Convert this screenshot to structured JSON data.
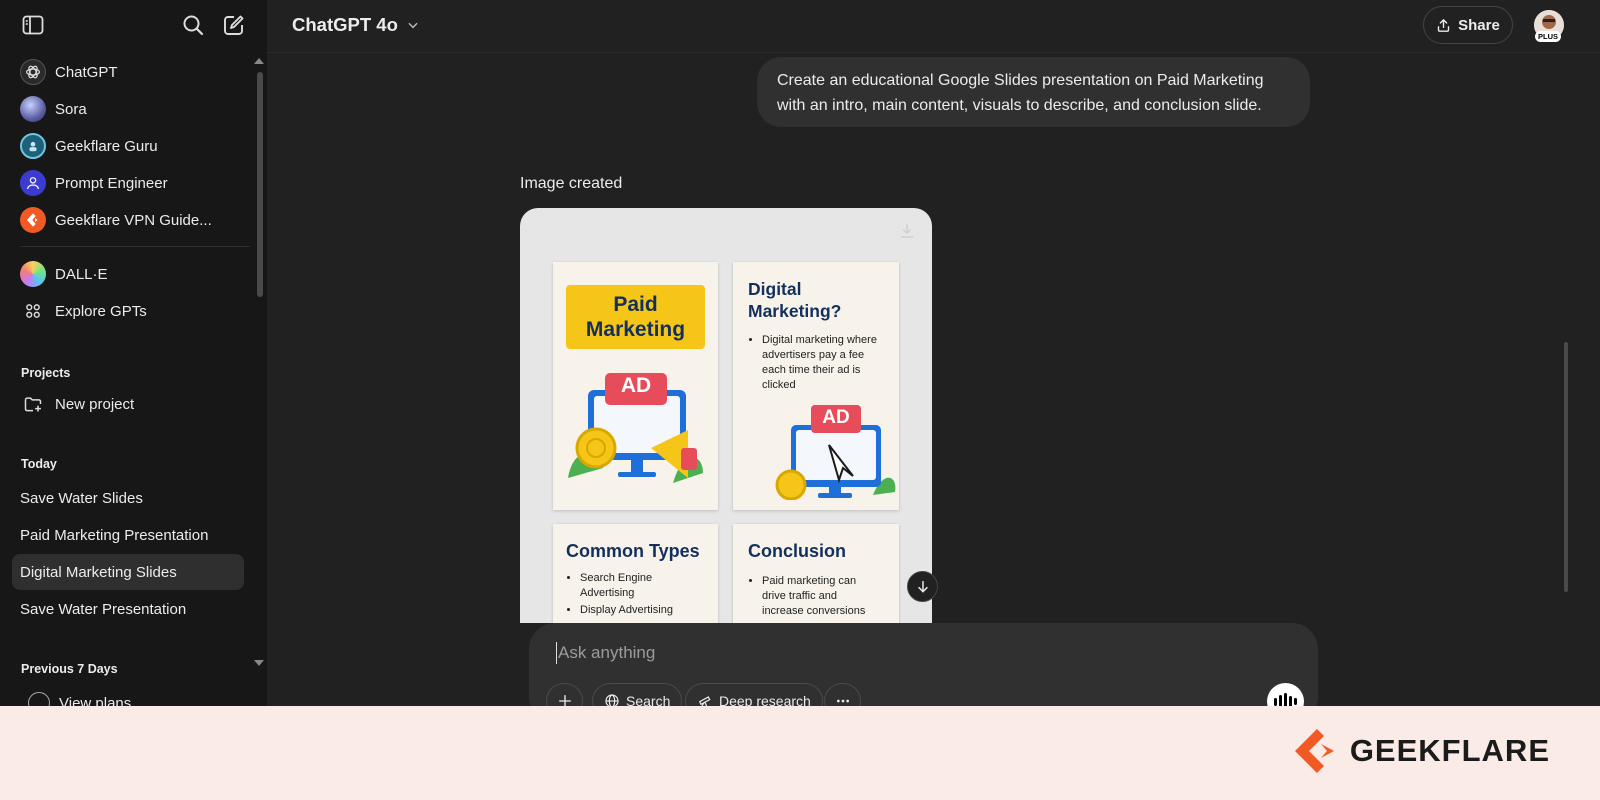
{
  "sidebar": {
    "gpts": [
      {
        "label": "ChatGPT",
        "icon": "openai-logo-icon"
      },
      {
        "label": "Sora",
        "icon": "sora-icon"
      },
      {
        "label": "Geekflare Guru",
        "icon": "geekflare-guru-icon"
      },
      {
        "label": "Prompt Engineer",
        "icon": "prompt-engineer-icon"
      },
      {
        "label": "Geekflare VPN Guide...",
        "icon": "geekflare-logo-icon"
      }
    ],
    "dalle": "DALL·E",
    "explore": "Explore GPTs",
    "projects_heading": "Projects",
    "new_project": "New project",
    "today_heading": "Today",
    "today": [
      "Save Water Slides",
      "Paid Marketing Presentation",
      "Digital Marketing Slides",
      "Save Water Presentation"
    ],
    "active_index": 2,
    "prev7_heading": "Previous 7 Days",
    "view_plans": "View plans"
  },
  "header": {
    "model": "ChatGPT 4o",
    "share": "Share",
    "plan_badge": "PLUS"
  },
  "chat": {
    "user_message": "Create an educational Google Slides presentation on Paid Marketing with an intro, main content, visuals to describe, and conclusion slide.",
    "image_created": "Image created"
  },
  "slides": {
    "s1_title": "Paid Marketing",
    "s1_ad": "AD",
    "s2_title": "Digital Marketing?",
    "s2_bullet": "Digital marketing where advertisers pay a fee each time their ad is clicked",
    "s2_ad": "AD",
    "s3_title": "Common Types",
    "s3_bullets": [
      "Search Engine Advertising",
      "Display Advertising"
    ],
    "s4_title": "Conclusion",
    "s4_bullet": "Paid marketing can drive traffic and increase conversions"
  },
  "composer": {
    "placeholder": "Ask anything",
    "search": "Search",
    "deep_research": "Deep research"
  },
  "footer": {
    "brand": "GEEKFLARE"
  },
  "colors": {
    "bg": "#212121",
    "sidebar": "#171717",
    "bubble": "#303030",
    "brand_orange": "#f15a24",
    "slide_navy": "#13305c",
    "slide_yellow": "#f5c518",
    "ad_red": "#e74c5b"
  }
}
